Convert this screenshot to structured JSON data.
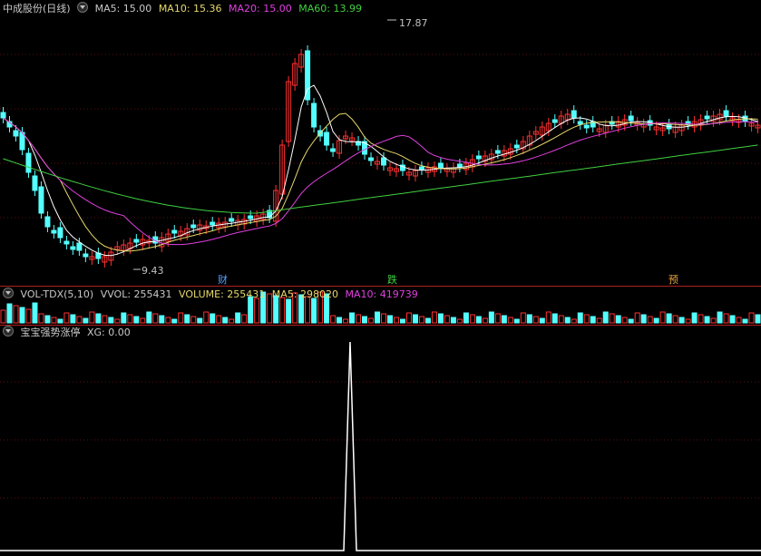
{
  "price_header": {
    "stock_label": "中成股份(日线)",
    "ma5": "MA5: 15.00",
    "ma10": "MA10: 15.36",
    "ma20": "MA20: 15.00",
    "ma60": "MA60: 13.99"
  },
  "price_annotations": {
    "high": "17.87",
    "low": "9.43",
    "marker_cai": "财",
    "marker_die": "跌",
    "marker_yu": "预"
  },
  "volume_header": {
    "indicator": "VOL-TDX(5,10)",
    "vvol": "VVOL: 255431",
    "volume": "VOLUME: 255431",
    "ma5": "MA5: 298020",
    "ma10": "MA10: 419739"
  },
  "signal_header": {
    "indicator": "宝宝强势涨停",
    "xg": "XG: 0.00"
  },
  "colors": {
    "up": "#ff3030",
    "down": "#54ffff",
    "ma5": "#ffffff",
    "ma10": "#e6d86a",
    "ma20": "#e040e0",
    "ma60": "#40d040",
    "separator": "#b02020"
  },
  "chart_data": {
    "type": "candlestick",
    "price_extremes": {
      "high": 17.87,
      "low": 9.43
    },
    "moving_averages": {
      "MA5": 15.0,
      "MA10": 15.36,
      "MA20": 15.0,
      "MA60": 13.99
    },
    "volume": {
      "VVOL": 255431,
      "VOLUME": 255431,
      "MA5": 298020,
      "MA10": 419739
    },
    "signal": {
      "name": "宝宝强势涨停",
      "XG": 0.0
    }
  }
}
